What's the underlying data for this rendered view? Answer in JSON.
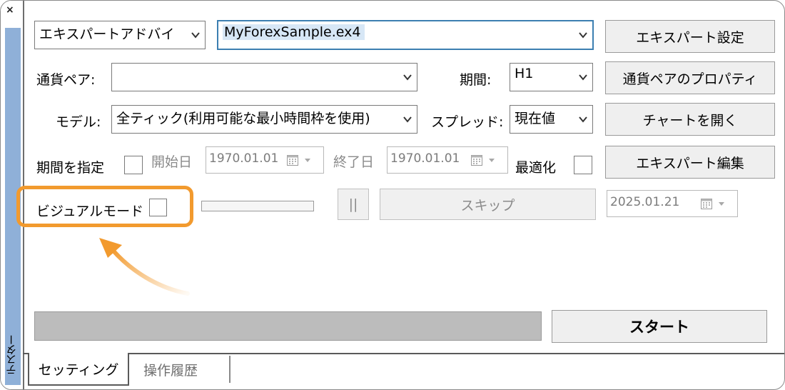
{
  "sidebar": {
    "close_glyph": "×",
    "tab_label": "テスター"
  },
  "row1": {
    "type_select": "エキスパートアドバイザ",
    "ea_select": "MyForexSample.ex4",
    "ea_settings_button": "エキスパート設定"
  },
  "row2": {
    "pair_label": "通貨ペア:",
    "pair_value": "",
    "period_label": "期間:",
    "period_value": "H1",
    "pair_props_button": "通貨ペアのプロパティ"
  },
  "row3": {
    "model_label": "モデル:",
    "model_value": "全ティック(利用可能な最小時間枠を使用)",
    "spread_label": "スプレッド:",
    "spread_value": "現在値",
    "open_chart_button": "チャートを開く"
  },
  "row4": {
    "use_date_label": "期間を指定",
    "start_label": "開始日",
    "start_date": "1970.01.01",
    "end_label": "終了日",
    "end_date": "1970.01.01",
    "optimize_label": "最適化",
    "ea_edit_button": "エキスパート編集"
  },
  "row5": {
    "visual_mode_label": "ビジュアルモード",
    "pause_button": "||",
    "skip_button": "スキップ",
    "skip_date": "2025.01.21"
  },
  "bottom": {
    "start_button": "スタート"
  },
  "tabs": [
    {
      "label": "セッティング"
    },
    {
      "label": "操作履歴"
    }
  ],
  "colors": {
    "highlight": "#f29a2e",
    "side_strip": "#8fb0d8",
    "focus_border": "#3c7fb1"
  }
}
